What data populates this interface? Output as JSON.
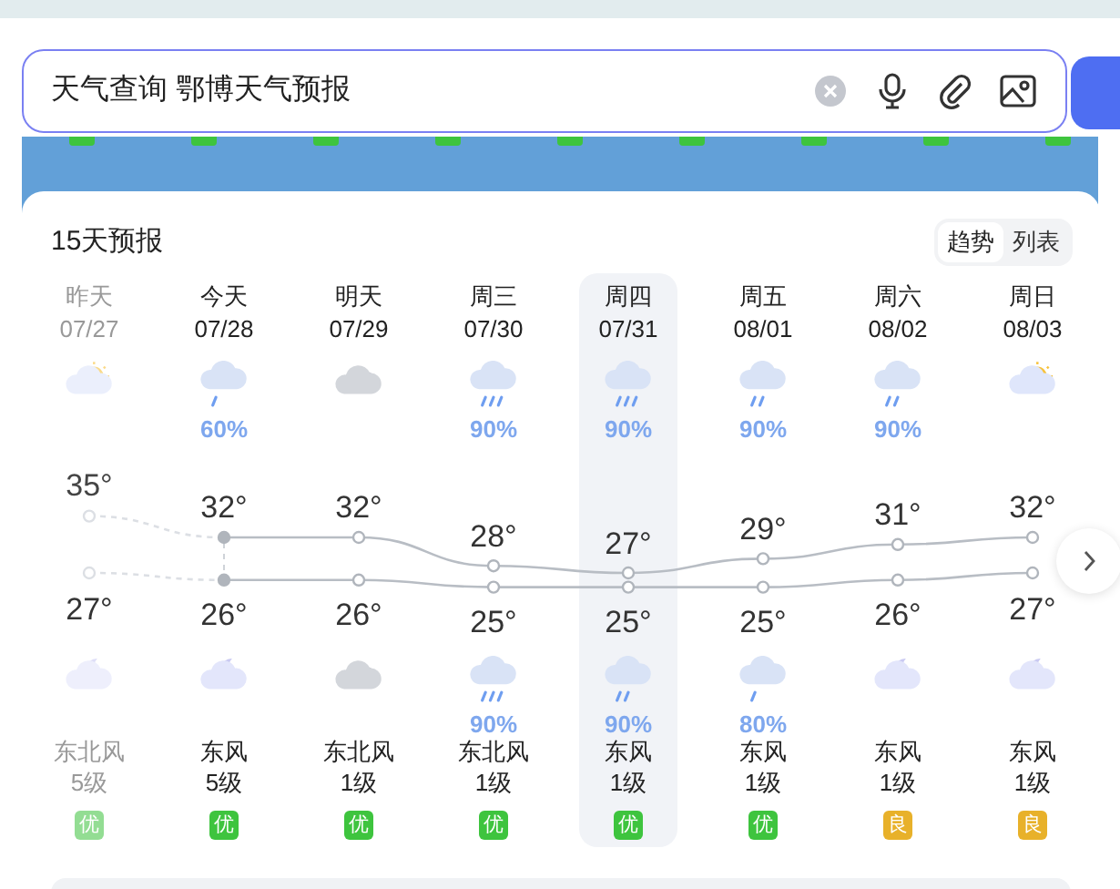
{
  "search": {
    "value": "天气查询 鄂博天气预报"
  },
  "forecast": {
    "title": "15天预报",
    "view_tabs": [
      {
        "label": "趋势",
        "selected": true
      },
      {
        "label": "列表",
        "selected": false
      }
    ],
    "days": [
      {
        "name": "昨天",
        "date": "07/27",
        "past": true,
        "today": false,
        "selected": false,
        "day": {
          "kind": "partly-cloudy"
        },
        "high": "35°",
        "low": "27°",
        "night": {
          "kind": "moon-cloud"
        },
        "wind": "东北风",
        "wind_level": "5级",
        "aqi": {
          "label": "优",
          "color": "#93dd93"
        }
      },
      {
        "name": "今天",
        "date": "07/28",
        "past": false,
        "today": true,
        "selected": false,
        "day": {
          "kind": "light-rain",
          "precip": "60%"
        },
        "high": "32°",
        "low": "26°",
        "night": {
          "kind": "moon-cloud"
        },
        "wind": "东风",
        "wind_level": "5级",
        "aqi": {
          "label": "优",
          "color": "#3ec43e"
        }
      },
      {
        "name": "明天",
        "date": "07/29",
        "past": false,
        "today": false,
        "selected": false,
        "day": {
          "kind": "cloudy"
        },
        "high": "32°",
        "low": "26°",
        "night": {
          "kind": "cloudy"
        },
        "wind": "东北风",
        "wind_level": "1级",
        "aqi": {
          "label": "优",
          "color": "#3ec43e"
        }
      },
      {
        "name": "周三",
        "date": "07/30",
        "past": false,
        "today": false,
        "selected": false,
        "day": {
          "kind": "heavy-rain",
          "precip": "90%"
        },
        "high": "28°",
        "low": "25°",
        "night": {
          "kind": "heavy-rain",
          "precip": "90%"
        },
        "wind": "东北风",
        "wind_level": "1级",
        "aqi": {
          "label": "优",
          "color": "#3ec43e"
        }
      },
      {
        "name": "周四",
        "date": "07/31",
        "past": false,
        "today": false,
        "selected": true,
        "day": {
          "kind": "heavy-rain",
          "precip": "90%"
        },
        "high": "27°",
        "low": "25°",
        "night": {
          "kind": "moderate-rain",
          "precip": "90%"
        },
        "wind": "东风",
        "wind_level": "1级",
        "aqi": {
          "label": "优",
          "color": "#3ec43e"
        }
      },
      {
        "name": "周五",
        "date": "08/01",
        "past": false,
        "today": false,
        "selected": false,
        "day": {
          "kind": "moderate-rain",
          "precip": "90%"
        },
        "high": "29°",
        "low": "25°",
        "night": {
          "kind": "light-rain",
          "precip": "80%"
        },
        "wind": "东风",
        "wind_level": "1级",
        "aqi": {
          "label": "优",
          "color": "#3ec43e"
        }
      },
      {
        "name": "周六",
        "date": "08/02",
        "past": false,
        "today": false,
        "selected": false,
        "day": {
          "kind": "moderate-rain",
          "precip": "90%"
        },
        "high": "31°",
        "low": "26°",
        "night": {
          "kind": "moon-cloud"
        },
        "wind": "东风",
        "wind_level": "1级",
        "aqi": {
          "label": "良",
          "color": "#e8b12a"
        }
      },
      {
        "name": "周日",
        "date": "08/03",
        "past": false,
        "today": false,
        "selected": false,
        "day": {
          "kind": "partly-cloudy"
        },
        "high": "32°",
        "low": "27°",
        "night": {
          "kind": "moon-cloud"
        },
        "wind": "东风",
        "wind_level": "1级",
        "aqi": {
          "label": "良",
          "color": "#e8b12a"
        }
      }
    ]
  }
}
